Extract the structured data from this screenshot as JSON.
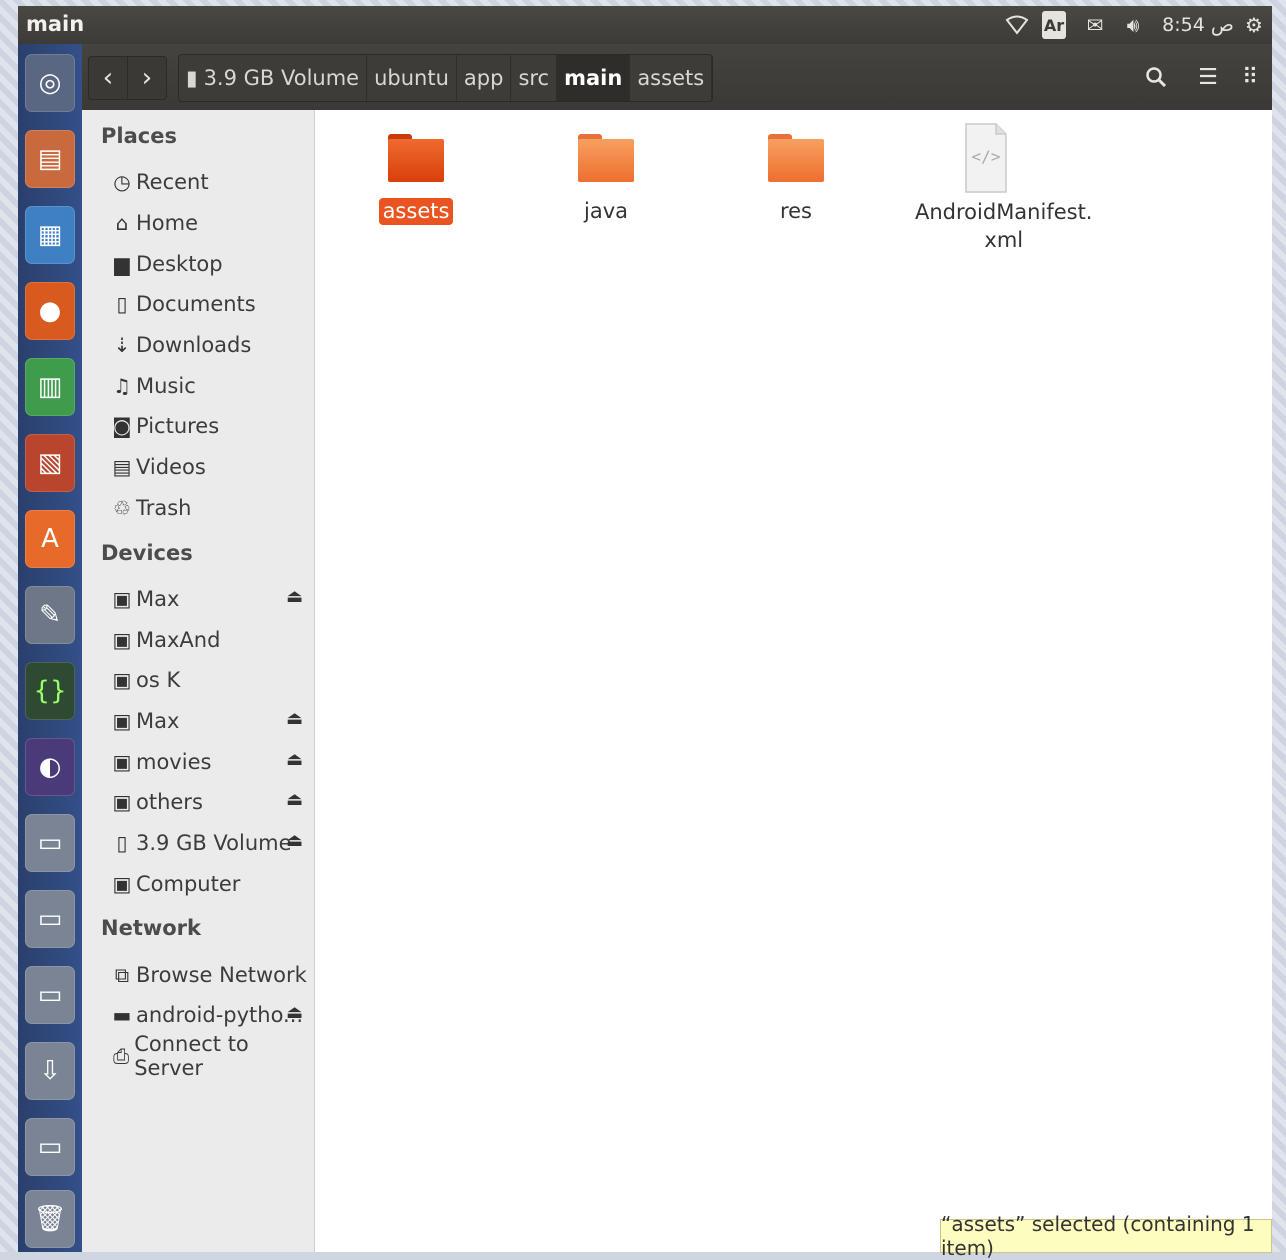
{
  "window": {
    "title": "main"
  },
  "indicators": {
    "keyboard": "Ar",
    "clock": "8:54 ص"
  },
  "breadcrumb": [
    "3.9 GB Volume",
    "ubuntu",
    "app",
    "src",
    "main",
    "assets"
  ],
  "breadcrumb_active_index": 4,
  "sidebar": {
    "places_title": "Places",
    "places": [
      {
        "label": "Recent",
        "icon": "clock-icon"
      },
      {
        "label": "Home",
        "icon": "home-icon"
      },
      {
        "label": "Desktop",
        "icon": "folder-icon"
      },
      {
        "label": "Documents",
        "icon": "document-icon"
      },
      {
        "label": "Downloads",
        "icon": "download-icon"
      },
      {
        "label": "Music",
        "icon": "music-icon"
      },
      {
        "label": "Pictures",
        "icon": "camera-icon"
      },
      {
        "label": "Videos",
        "icon": "film-icon"
      },
      {
        "label": "Trash",
        "icon": "trash-icon"
      }
    ],
    "devices_title": "Devices",
    "devices": [
      {
        "label": "Max",
        "icon": "drive-icon",
        "eject": true
      },
      {
        "label": "MaxAnd",
        "icon": "drive-icon",
        "eject": false
      },
      {
        "label": "os K",
        "icon": "drive-icon",
        "eject": false
      },
      {
        "label": "Max",
        "icon": "drive-icon",
        "eject": true
      },
      {
        "label": "movies",
        "icon": "drive-icon",
        "eject": true
      },
      {
        "label": "others",
        "icon": "drive-icon",
        "eject": true
      },
      {
        "label": "3.9 GB Volume",
        "icon": "usb-icon",
        "eject": true
      },
      {
        "label": "Computer",
        "icon": "drive-icon",
        "eject": false
      }
    ],
    "network_title": "Network",
    "network": [
      {
        "label": "Browse Network",
        "icon": "network-icon",
        "eject": false
      },
      {
        "label": "android-pytho...",
        "icon": "disc-icon",
        "eject": true
      },
      {
        "label": "Connect to Server",
        "icon": "server-icon",
        "eject": false
      }
    ]
  },
  "files": [
    {
      "name": "assets",
      "type": "folder",
      "selected": true
    },
    {
      "name": "java",
      "type": "folder",
      "selected": false
    },
    {
      "name": "res",
      "type": "folder",
      "selected": false
    },
    {
      "name_line1": "AndroidManifest.",
      "name_line2": "xml",
      "type": "xml",
      "selected": false
    }
  ],
  "status": "“assets” selected  (containing 1 item)",
  "colors": {
    "accent": "#e95420",
    "folder_selected": "#e04a10",
    "folder": "#f07a3a"
  }
}
